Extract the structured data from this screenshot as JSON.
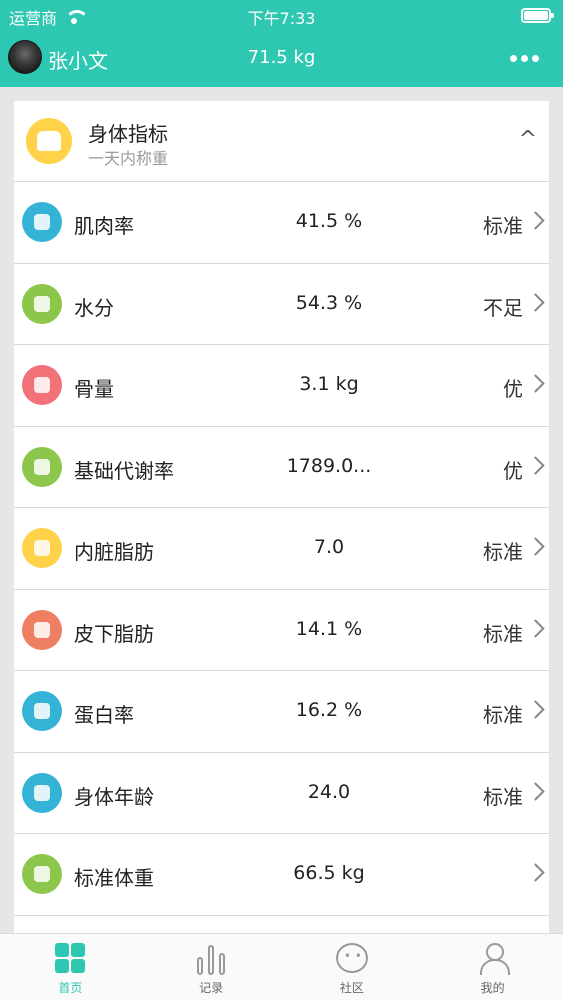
{
  "status_bar": {
    "carrier": "运营商",
    "time": "下午7:33"
  },
  "header": {
    "username": "张小文",
    "weight": "71.5 kg"
  },
  "card": {
    "title": "身体指标",
    "subtitle": "一天内称重",
    "collapse_glyph": "^",
    "rows": [
      {
        "name": "肌肉率",
        "value": "41.5 %",
        "status": "标准",
        "icon": "muscle-icon",
        "color": "#35b3d6"
      },
      {
        "name": "水分",
        "value": "54.3 %",
        "status": "不足",
        "icon": "water-drop-icon",
        "color": "#8cc64a"
      },
      {
        "name": "骨量",
        "value": "3.1 kg",
        "status": "优",
        "icon": "bone-icon",
        "color": "#f2727a"
      },
      {
        "name": "基础代谢率",
        "value": "1789.0...",
        "status": "优",
        "icon": "metabolism-icon",
        "color": "#8cc64a"
      },
      {
        "name": "内脏脂肪",
        "value": "7.0",
        "status": "标准",
        "icon": "lungs-icon",
        "color": "#ffd24a"
      },
      {
        "name": "皮下脂肪",
        "value": "14.1 %",
        "status": "标准",
        "icon": "skin-fat-icon",
        "color": "#ee7f63"
      },
      {
        "name": "蛋白率",
        "value": "16.2 %",
        "status": "标准",
        "icon": "protein-icon",
        "color": "#35b3d6"
      },
      {
        "name": "身体年龄",
        "value": "24.0",
        "status": "标准",
        "icon": "body-age-icon",
        "color": "#35b3d6"
      },
      {
        "name": "标准体重",
        "value": "66.5 kg",
        "status": "",
        "icon": "standard-weight-icon",
        "color": "#8cc64a"
      }
    ]
  },
  "tabs": [
    {
      "label": "首页",
      "icon": "home-icon",
      "active": true
    },
    {
      "label": "记录",
      "icon": "records-icon",
      "active": false
    },
    {
      "label": "社区",
      "icon": "community-icon",
      "active": false
    },
    {
      "label": "我的",
      "icon": "profile-icon",
      "active": false
    }
  ],
  "colors": {
    "accent": "#2ec7b1"
  }
}
